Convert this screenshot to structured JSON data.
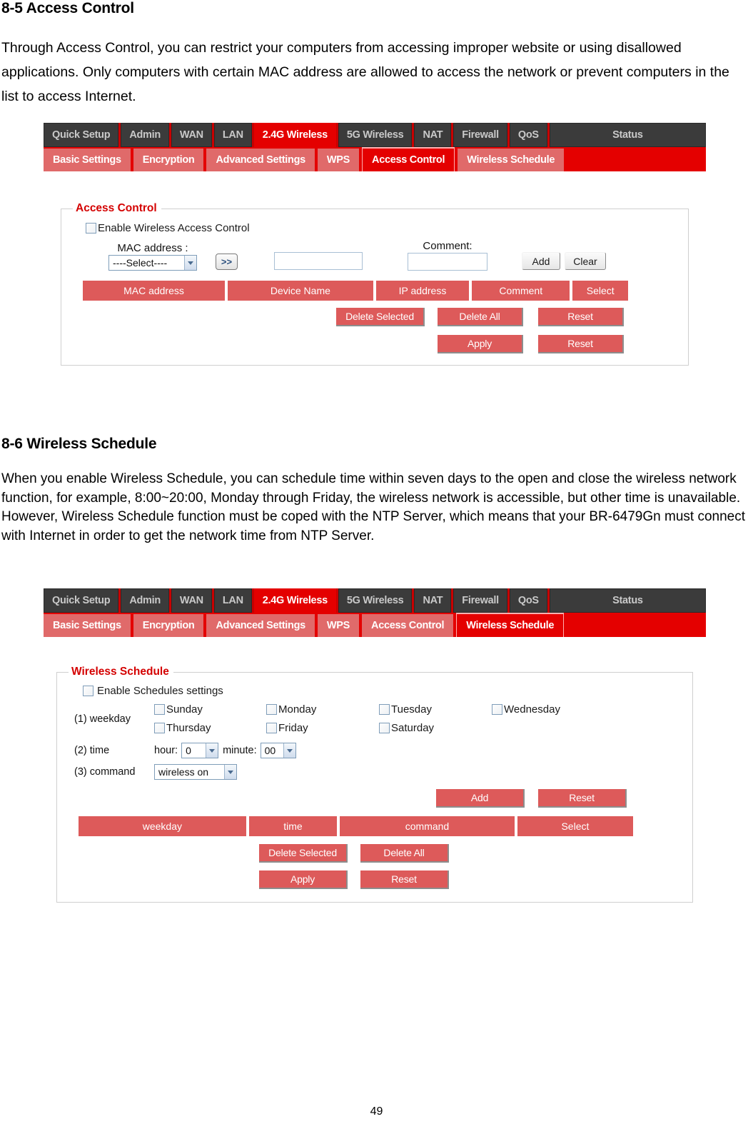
{
  "document": {
    "section1": {
      "heading": "8-5 Access Control",
      "paragraph": "Through Access Control, you can restrict your computers from accessing improper website or using disallowed applications. Only computers with certain MAC address are allowed to access the network or prevent computers in the list to access Internet."
    },
    "section2": {
      "heading": "8-6 Wireless Schedule",
      "paragraph": "When you enable Wireless Schedule, you can schedule time within seven days to the open and close the wireless network function, for example, 8:00~20:00, Monday through Friday, the wireless network is accessible, but other time is unavailable. However, Wireless Schedule function must be coped with the NTP Server, which means that your BR-6479Gn must connect with Internet in order to get the network time from NTP Server."
    },
    "page_number": "49"
  },
  "colors": {
    "nav_active_red": "#e40000",
    "nav_tab_dark": "#3b3b3b",
    "subtab_light_red": "#e06a6a",
    "legend_red": "#d40000",
    "button_red": "#dd5a5a"
  },
  "screenshot1": {
    "main_tabs": [
      {
        "label": "Quick Setup",
        "active": false
      },
      {
        "label": "Admin",
        "active": false
      },
      {
        "label": "WAN",
        "active": false
      },
      {
        "label": "LAN",
        "active": false
      },
      {
        "label": "2.4G Wireless",
        "active": true
      },
      {
        "label": "5G Wireless",
        "active": false
      },
      {
        "label": "NAT",
        "active": false
      },
      {
        "label": "Firewall",
        "active": false
      },
      {
        "label": "QoS",
        "active": false
      },
      {
        "label": "Status",
        "active": false
      }
    ],
    "sub_tabs": [
      {
        "label": "Basic Settings",
        "active": false
      },
      {
        "label": "Encryption",
        "active": false
      },
      {
        "label": "Advanced Settings",
        "active": false
      },
      {
        "label": "WPS",
        "active": false
      },
      {
        "label": "Access Control",
        "active": true
      },
      {
        "label": "Wireless Schedule",
        "active": false
      }
    ],
    "panel": {
      "legend": "Access Control",
      "enable_checkbox_label": "Enable Wireless Access Control",
      "mac_label": "MAC address :",
      "mac_select_value": "----Select----",
      "transfer_button": ">>",
      "mac_input_value": "",
      "comment_label": "Comment:",
      "comment_input_value": "",
      "add_button": "Add",
      "clear_button": "Clear",
      "table_headers": [
        "MAC address",
        "Device Name",
        "IP address",
        "Comment",
        "Select"
      ],
      "delete_selected_button": "Delete Selected",
      "delete_all_button": "Delete All",
      "reset_button_1": "Reset",
      "apply_button": "Apply",
      "reset_button_2": "Reset"
    }
  },
  "screenshot2": {
    "main_tabs": [
      {
        "label": "Quick Setup",
        "active": false
      },
      {
        "label": "Admin",
        "active": false
      },
      {
        "label": "WAN",
        "active": false
      },
      {
        "label": "LAN",
        "active": false
      },
      {
        "label": "2.4G Wireless",
        "active": true
      },
      {
        "label": "5G Wireless",
        "active": false
      },
      {
        "label": "NAT",
        "active": false
      },
      {
        "label": "Firewall",
        "active": false
      },
      {
        "label": "QoS",
        "active": false
      },
      {
        "label": "Status",
        "active": false
      }
    ],
    "sub_tabs": [
      {
        "label": "Basic Settings",
        "active": false
      },
      {
        "label": "Encryption",
        "active": false
      },
      {
        "label": "Advanced Settings",
        "active": false
      },
      {
        "label": "WPS",
        "active": false
      },
      {
        "label": "Access Control",
        "active": false
      },
      {
        "label": "Wireless Schedule",
        "active": true
      }
    ],
    "panel": {
      "legend": "Wireless Schedule",
      "enable_checkbox_label": "Enable Schedules settings",
      "weekday_label": "(1) weekday",
      "weekdays_row1": [
        "Sunday",
        "Monday",
        "Tuesday",
        "Wednesday"
      ],
      "weekdays_row2": [
        "Thursday",
        "Friday",
        "Saturday"
      ],
      "time_label": "(2) time",
      "hour_label": "hour:",
      "hour_value": "0",
      "minute_label": "minute:",
      "minute_value": "00",
      "command_label": "(3) command",
      "command_value": "wireless on",
      "add_button": "Add",
      "reset_button_top": "Reset",
      "table_headers": [
        "weekday",
        "time",
        "command",
        "Select"
      ],
      "delete_selected_button": "Delete Selected",
      "delete_all_button": "Delete All",
      "apply_button": "Apply",
      "reset_button_bottom": "Reset"
    }
  }
}
